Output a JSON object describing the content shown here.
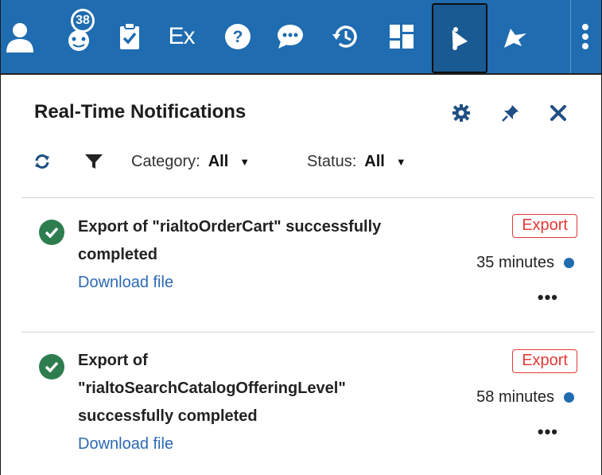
{
  "toolbar": {
    "badge_count": "38",
    "ex_label": "Ex",
    "icons": [
      "person-icon",
      "user-group-icon",
      "clipboard-check-icon",
      "ex-icon",
      "help-icon",
      "chat-icon",
      "history-icon",
      "dashboard-icon",
      "bell-icon",
      "plane-icon",
      "more-vertical-icon"
    ]
  },
  "panel": {
    "title": "Real-Time Notifications"
  },
  "filters": {
    "category_label": "Category:",
    "category_value": "All",
    "status_label": "Status:",
    "status_value": "All"
  },
  "notifications": [
    {
      "title": "Export of \"rialtoOrderCart\" successfully completed",
      "link": "Download file",
      "tag": "Export",
      "time": "35 minutes"
    },
    {
      "title": "Export of \"rialtoSearchCatalogOfferingLevel\" successfully completed",
      "link": "Download file",
      "tag": "Export",
      "time": "58 minutes"
    }
  ],
  "colors": {
    "toolbar_bg": "#1f6cb0",
    "success": "#2e7d4f",
    "tag": "#e53935",
    "link": "#2c69b4",
    "unread_dot": "#1f6cb0"
  }
}
